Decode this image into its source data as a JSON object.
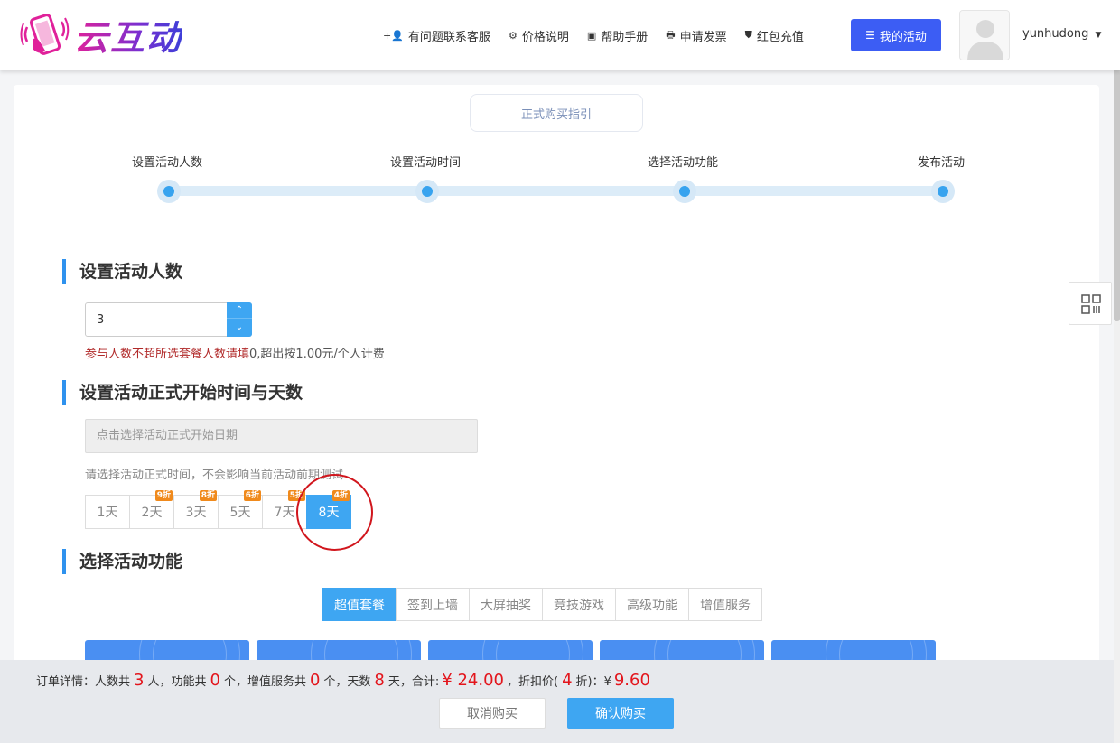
{
  "header": {
    "brand": "云互动",
    "nav": [
      {
        "icon": "user-plus-icon",
        "glyph": "+👤",
        "label": "有问题联系客服"
      },
      {
        "icon": "gear-icon",
        "glyph": "⚙",
        "label": "价格说明"
      },
      {
        "icon": "book-icon",
        "glyph": "▣",
        "label": "帮助手册"
      },
      {
        "icon": "printer-icon",
        "glyph": "🖶",
        "label": "申请发票"
      },
      {
        "icon": "shield-check-icon",
        "glyph": "⛊",
        "label": "红包充值"
      }
    ],
    "my_activity": "我的活动",
    "username": "yunhudong"
  },
  "guide_button": "正式购买指引",
  "steps": [
    "设置活动人数",
    "设置活动时间",
    "选择活动功能",
    "发布活动"
  ],
  "section_people": {
    "title": "设置活动人数",
    "value": "3",
    "hint_red": "参与人数不超所选套餐人数请填",
    "hint_rest": "0,超出按1.00元/个人计费"
  },
  "section_time": {
    "title": "设置活动正式开始时间与天数",
    "date_placeholder": "点击选择活动正式开始日期",
    "hint": "请选择活动正式时间，不会影响当前活动前期测试",
    "days": [
      {
        "label": "1天",
        "badge": ""
      },
      {
        "label": "2天",
        "badge": "9折"
      },
      {
        "label": "3天",
        "badge": "8折"
      },
      {
        "label": "5天",
        "badge": "6折"
      },
      {
        "label": "7天",
        "badge": "5折"
      },
      {
        "label": "8天",
        "badge": "4折"
      }
    ],
    "selected_day": "8天"
  },
  "section_features": {
    "title": "选择活动功能",
    "tabs": [
      "超值套餐",
      "签到上墙",
      "大屏抽奖",
      "竞技游戏",
      "高级功能",
      "增值服务"
    ],
    "active_tab": "超值套餐"
  },
  "order": {
    "prefix": "订单详情：人数共",
    "people": "3",
    "t1": "人，功能共",
    "features": "0",
    "t2": "个，增值服务共",
    "services": "0",
    "t3": "个，天数",
    "days": "8",
    "t4": "天，合计:",
    "total": "¥ 24.00",
    "t5": "，折扣价(",
    "discount": "4",
    "t6": "折)：¥",
    "discount_price": "9.60"
  },
  "buttons": {
    "cancel": "取消购买",
    "confirm": "确认购买"
  },
  "colors": {
    "primary": "#3ea6f2",
    "nav_button": "#3c5df4",
    "accent_red": "#e3151c",
    "badge_orange": "#f08a1c",
    "title_bar": "#2f92ee"
  }
}
